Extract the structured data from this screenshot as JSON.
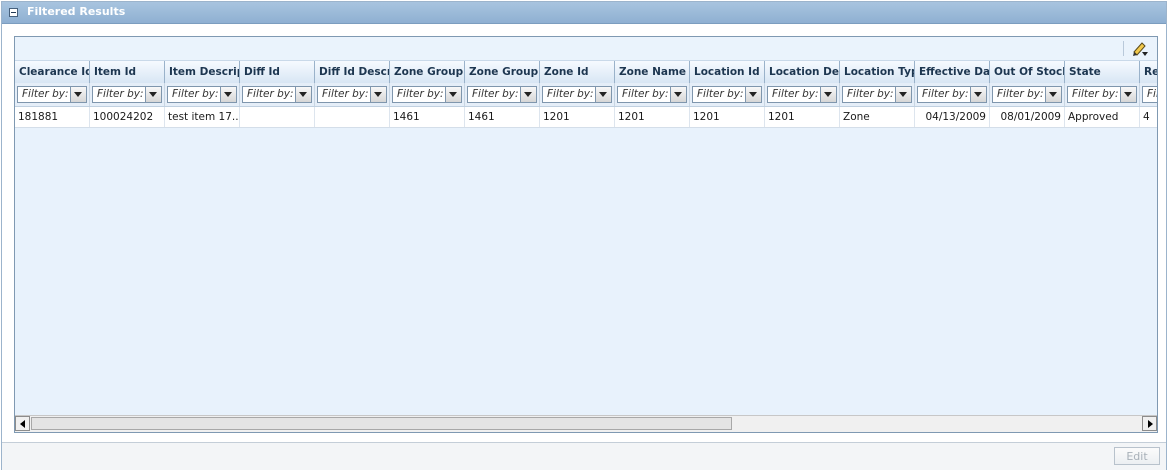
{
  "panel": {
    "title": "Filtered Results"
  },
  "grid": {
    "filter_placeholder": "Filter by:",
    "columns": [
      {
        "label": "Clearance Id",
        "width": 75
      },
      {
        "label": "Item Id",
        "width": 75
      },
      {
        "label": "Item Descripti",
        "width": 75
      },
      {
        "label": "Diff Id",
        "width": 75
      },
      {
        "label": "Diff Id Descrip",
        "width": 75
      },
      {
        "label": "Zone Group Id",
        "width": 75
      },
      {
        "label": "Zone Group Na",
        "width": 75
      },
      {
        "label": "Zone Id",
        "width": 75
      },
      {
        "label": "Zone Name",
        "width": 75
      },
      {
        "label": "Location Id",
        "width": 75
      },
      {
        "label": "Location Desc",
        "width": 75
      },
      {
        "label": "Location Type",
        "width": 75
      },
      {
        "label": "Effective Dat",
        "width": 75
      },
      {
        "label": "Out Of Stock",
        "width": 75
      },
      {
        "label": "State",
        "width": 75
      },
      {
        "label": "Re",
        "width": 20
      }
    ],
    "rows": [
      [
        "181881",
        "100024202",
        "test item 17...",
        "",
        "",
        "1461",
        "1461",
        "1201",
        "1201",
        "1201",
        "1201",
        "Zone",
        "04/13/2009",
        "08/01/2009",
        "Approved",
        "4"
      ]
    ]
  },
  "footer": {
    "edit_label": "Edit"
  }
}
